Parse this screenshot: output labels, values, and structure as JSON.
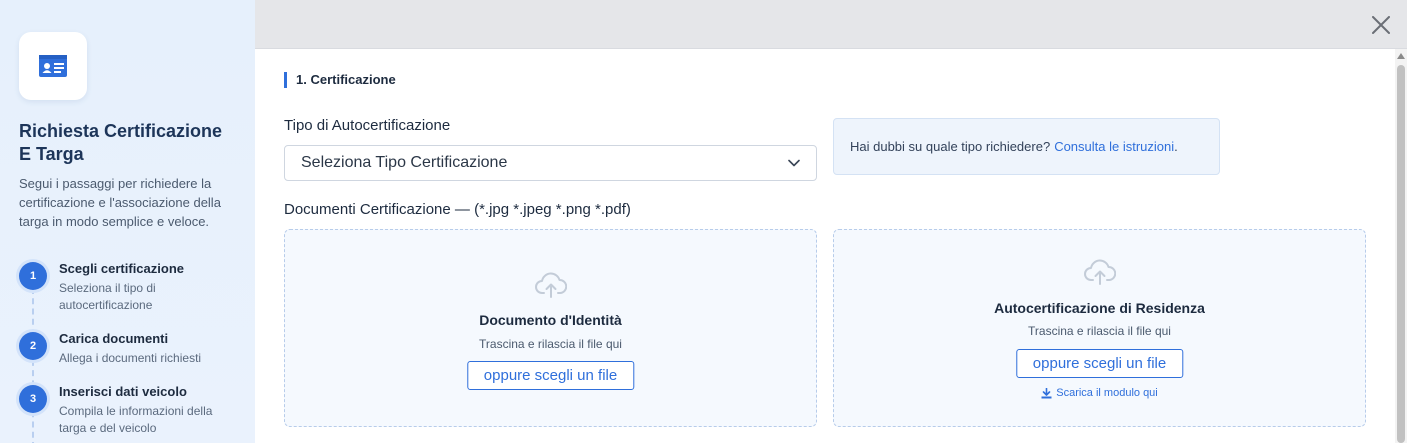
{
  "sidebar": {
    "title": "Richiesta Certificazione E Targa",
    "description": "Segui i passaggi per richiedere la certificazione e l'associazione della targa in modo semplice e veloce.",
    "steps": [
      {
        "number": "1",
        "title": "Scegli certificazione",
        "subtitle": "Seleziona il tipo di autocertificazione"
      },
      {
        "number": "2",
        "title": "Carica documenti",
        "subtitle": "Allega i documenti richiesti"
      },
      {
        "number": "3",
        "title": "Inserisci dati veicolo",
        "subtitle": "Compila le informazioni della targa e del veicolo"
      }
    ]
  },
  "main": {
    "section_title": "1. Certificazione",
    "type_label": "Tipo di Autocertificazione",
    "type_select_value": "Seleziona Tipo Certificazione",
    "info_text": "Hai dubbi su quale tipo richiedere?",
    "info_link": "Consulta le istruzioni",
    "info_period": ".",
    "docs_label": "Documenti Certificazione",
    "docs_dash": "—",
    "docs_formats": "(*.jpg *.jpeg *.png *.pdf)",
    "uploads": [
      {
        "title": "Documento d'Identità",
        "hint": "Trascina e rilascia il file qui",
        "button": "oppure scegli un file"
      },
      {
        "title": "Autocertificazione di Residenza",
        "hint": "Trascina e rilascia il file qui",
        "button": "oppure scegli un file",
        "download": "Scarica il modulo qui"
      }
    ]
  },
  "colors": {
    "accent": "#2f6fdb",
    "sidebar_bg": "#e6f0fc",
    "dropzone_bg": "#f5f9fe"
  },
  "icons": {
    "app": "id-card-icon",
    "close": "close-icon",
    "select": "chevron-down-icon",
    "upload": "cloud-upload-icon",
    "download": "download-icon"
  }
}
